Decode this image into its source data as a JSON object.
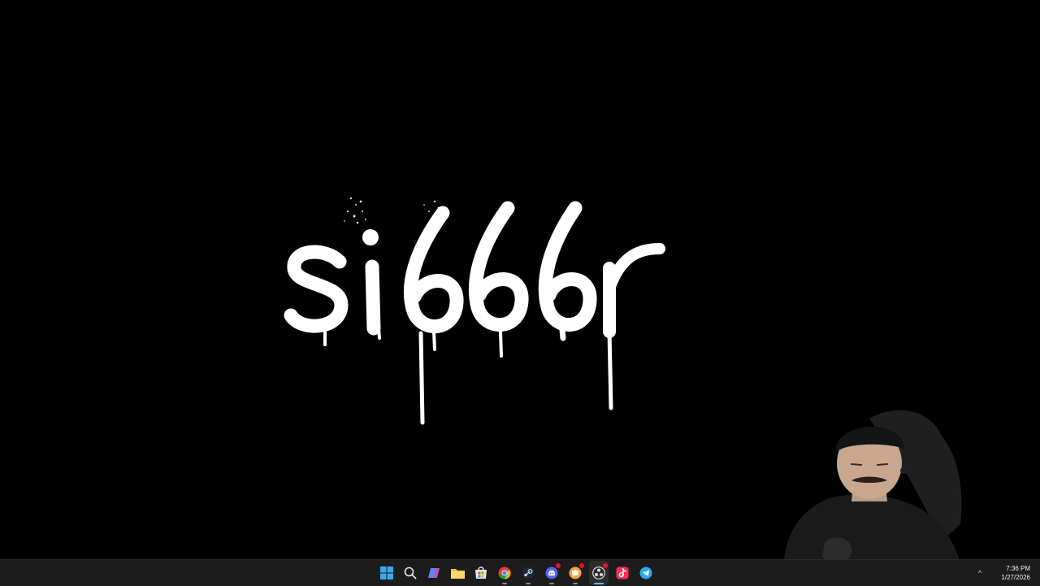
{
  "wallpaper": {
    "logo_text": "si666r",
    "background_color": "#000000",
    "logo_color": "#ffffff"
  },
  "taskbar": {
    "background_color": "#1c1c1c",
    "accent_color": "#4cc2ff",
    "apps": [
      {
        "name": "start",
        "icon": "windows-start-icon",
        "running": false,
        "active": false,
        "badge": false
      },
      {
        "name": "search",
        "icon": "search-icon",
        "running": false,
        "active": false,
        "badge": false
      },
      {
        "name": "copilot",
        "icon": "copilot-icon",
        "running": false,
        "active": false,
        "badge": false
      },
      {
        "name": "file-explorer",
        "icon": "folder-icon",
        "running": false,
        "active": false,
        "badge": false
      },
      {
        "name": "microsoft-store",
        "icon": "store-icon",
        "running": false,
        "active": false,
        "badge": false
      },
      {
        "name": "chrome",
        "icon": "chrome-icon",
        "running": true,
        "active": false,
        "badge": false
      },
      {
        "name": "steam",
        "icon": "steam-icon",
        "running": true,
        "active": false,
        "badge": false
      },
      {
        "name": "discord",
        "icon": "discord-icon",
        "running": true,
        "active": false,
        "badge": true
      },
      {
        "name": "messenger",
        "icon": "chat-bubble-icon",
        "running": true,
        "active": false,
        "badge": true
      },
      {
        "name": "obs-studio",
        "icon": "obs-icon",
        "running": true,
        "active": true,
        "badge": true
      },
      {
        "name": "tiktok-live",
        "icon": "tiktok-icon",
        "running": false,
        "active": false,
        "badge": false
      },
      {
        "name": "telegram",
        "icon": "telegram-icon",
        "running": false,
        "active": false,
        "badge": false
      }
    ],
    "tray": {
      "overflow_glyph": "^",
      "time": "7:36 PM",
      "date": "1/27/2026"
    }
  }
}
